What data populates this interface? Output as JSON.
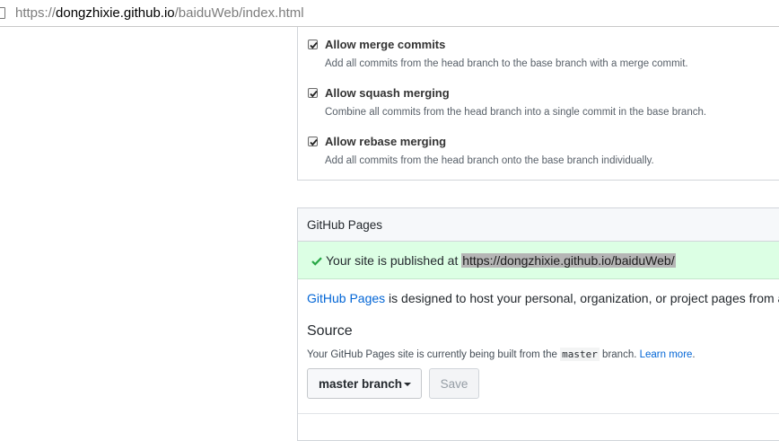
{
  "browser": {
    "url_scheme": "https://",
    "url_host": "dongzhixie.github.io",
    "url_path": "/baiduWeb/index.html"
  },
  "merge_options": [
    {
      "label": "Allow merge commits",
      "note": "Add all commits from the head branch to the base branch with a merge commit.",
      "checked": true
    },
    {
      "label": "Allow squash merging",
      "note": "Combine all commits from the head branch into a single commit in the base branch.",
      "checked": true
    },
    {
      "label": "Allow rebase merging",
      "note": "Add all commits from the head branch onto the base branch individually.",
      "checked": true
    }
  ],
  "pages": {
    "title": "GitHub Pages",
    "published_prefix": "Your site is published at ",
    "published_url": "https://dongzhixie.github.io/baiduWeb/",
    "intro_link": "GitHub Pages",
    "intro_text": " is designed to host your personal, organization, or project pages from a",
    "source_heading": "Source",
    "source_note_prefix": "Your GitHub Pages site is currently being built from the ",
    "source_branch_code": "master",
    "source_note_suffix": " branch. ",
    "learn_more": "Learn more",
    "learn_more_suffix": ".",
    "branch_select": "master branch",
    "save_label": "Save"
  },
  "colors": {
    "success_bg": "#dcffe4",
    "link": "#0366d6",
    "checkmark": "#28a745"
  }
}
